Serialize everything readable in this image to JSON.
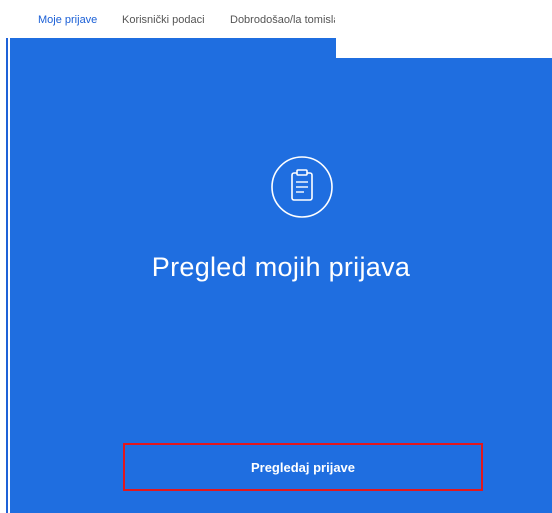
{
  "nav": {
    "items": [
      {
        "label": "Moje prijave",
        "active": true
      },
      {
        "label": "Korisnički podaci",
        "active": false
      },
      {
        "label": "Dobrodošao/la tomislav",
        "active": false
      }
    ]
  },
  "panel": {
    "icon": "clipboard-icon",
    "title": "Pregled mojih prijava",
    "button_label": "Pregledaj prijave",
    "background_color": "#1f6ee0"
  },
  "colors": {
    "accent": "#1a5fd6",
    "highlight": "#e3171c",
    "panel_text": "#ffffff"
  }
}
